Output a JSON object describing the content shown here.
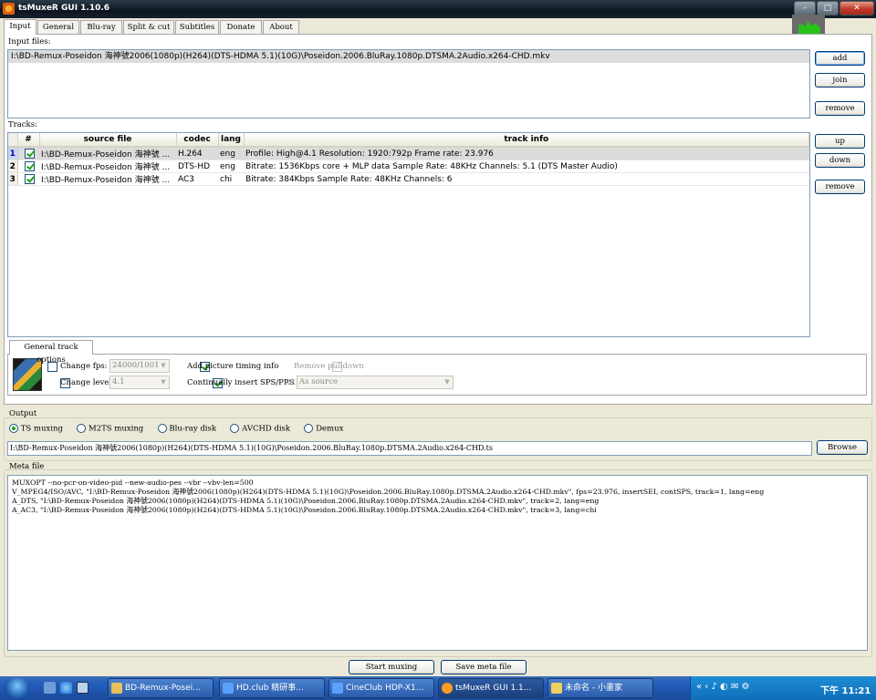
{
  "window": {
    "title": "tsMuxeR GUI 1.10.6",
    "min_glyph": "–",
    "max_glyph": "□",
    "close_glyph": "✕"
  },
  "tabs": [
    "Input",
    "General",
    "Blu-ray",
    "Split & cut",
    "Subtitles",
    "Donate",
    "About"
  ],
  "input_files": {
    "label": "Input files:",
    "items": [
      "I:\\BD-Remux-Poseidon 海神號2006(1080p)(H264)(DTS-HDMA 5.1)(10G)\\Poseidon.2006.BluRay.1080p.DTSMA.2Audio.x264-CHD.mkv"
    ],
    "buttons": {
      "add": "add",
      "join": "join",
      "remove": "remove"
    }
  },
  "tracks": {
    "label": "Tracks:",
    "columns": [
      "#",
      "source file",
      "codec",
      "lang",
      "track info"
    ],
    "rows": [
      {
        "num": "1",
        "source": "I:\\BD-Remux-Poseidon 海神號 ...",
        "codec": "H.264",
        "lang": "eng",
        "info": "Profile: High@4.1  Resolution: 1920:792p  Frame rate: 23.976"
      },
      {
        "num": "2",
        "source": "I:\\BD-Remux-Poseidon 海神號 ...",
        "codec": "DTS-HD",
        "lang": "eng",
        "info": "Bitrate: 1536Kbps  core + MLP data Sample Rate: 48KHz  Channels: 5.1 (DTS Master Audio)"
      },
      {
        "num": "3",
        "source": "I:\\BD-Remux-Poseidon 海神號 ...",
        "codec": "AC3",
        "lang": "chi",
        "info": "Bitrate: 384Kbps Sample Rate: 48KHz Channels: 6"
      }
    ],
    "buttons": {
      "up": "up",
      "down": "down",
      "remove": "remove"
    }
  },
  "general_track_options": {
    "tab_label": "General track options",
    "change_fps": {
      "label": "Change fps:",
      "value": "24000/1001"
    },
    "change_level": {
      "label": "Change level:",
      "value": "4.1"
    },
    "add_picture_timing": "Add picture timing info",
    "insert_sps_pps": "Continually insert SPS/PPS",
    "remove_pulldown": "Remove pulldown",
    "ar_label": "AR",
    "ar_value": "As source"
  },
  "output": {
    "label": "Output",
    "modes": [
      "TS muxing",
      "M2TS muxing",
      "Blu-ray disk",
      "AVCHD disk",
      "Demux"
    ],
    "path": "I:\\BD-Remux-Poseidon 海神號2006(1080p)(H264)(DTS-HDMA 5.1)(10G)\\Poseidon.2006.BluRay.1080p.DTSMA.2Audio.x264-CHD.ts",
    "browse": "Browse"
  },
  "meta_file": {
    "label": "Meta file",
    "lines": [
      "MUXOPT --no-pcr-on-video-pid --new-audio-pes --vbr  --vbv-len=500",
      "V_MPEG4/ISO/AVC, \"I:\\BD-Remux-Poseidon 海神號2006(1080p)(H264)(DTS-HDMA 5.1)(10G)\\Poseidon.2006.BluRay.1080p.DTSMA.2Audio.x264-CHD.mkv\", fps=23.976, insertSEI, contSPS, track=1, lang=eng",
      "A_DTS, \"I:\\BD-Remux-Poseidon 海神號2006(1080p)(H264)(DTS-HDMA 5.1)(10G)\\Poseidon.2006.BluRay.1080p.DTSMA.2Audio.x264-CHD.mkv\", track=2, lang=eng",
      "A_AC3, \"I:\\BD-Remux-Poseidon 海神號2006(1080p)(H264)(DTS-HDMA 5.1)(10G)\\Poseidon.2006.BluRay.1080p.DTSMA.2Audio.x264-CHD.mkv\", track=3, lang=chi"
    ]
  },
  "footer": {
    "start": "Start muxing",
    "save": "Save meta file"
  },
  "taskbar": {
    "tasks": [
      "BD-Remux-Posei...",
      "HD.club 精研事...",
      "CineClub HDP-X1...",
      "tsMuxeR GUI 1.1...",
      "未命名 - 小畫家"
    ],
    "tray_glyphs": "« ‹ ♪ ◐ ✉ ⚙",
    "clock": "下午 11:21"
  }
}
